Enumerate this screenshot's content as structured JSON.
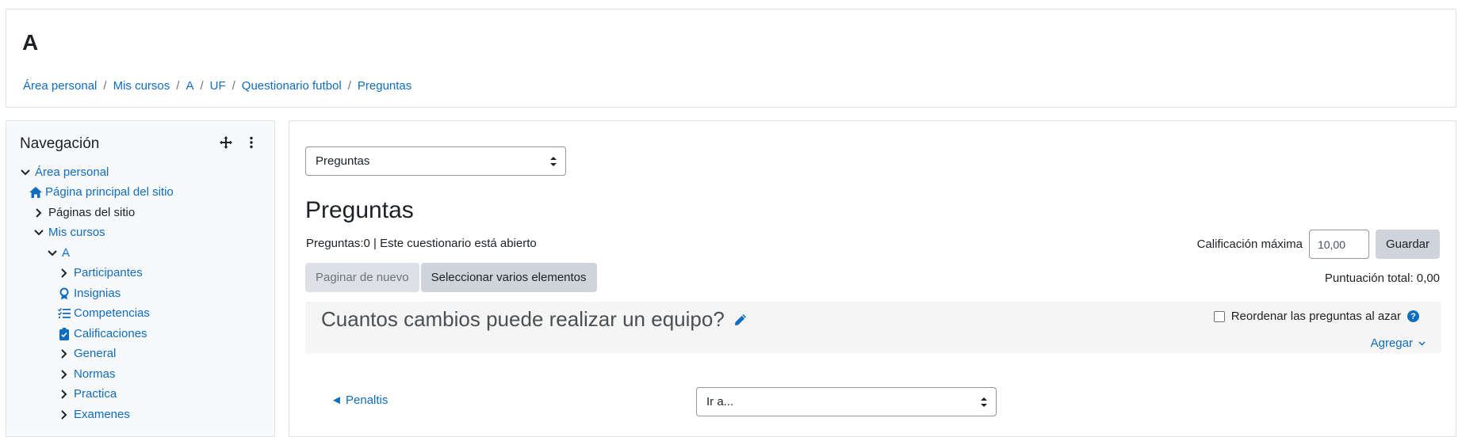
{
  "header": {
    "course_title": "A",
    "breadcrumb": [
      "Área personal",
      "Mis cursos",
      "A",
      "UF",
      "Questionario futbol",
      "Preguntas"
    ],
    "separator": "/"
  },
  "nav": {
    "title": "Navegación",
    "move_icon": "move-icon",
    "menu_icon": "kebab-menu-icon",
    "items": [
      {
        "label": "Área personal",
        "icon": "chevron-down-icon"
      },
      {
        "label": "Página principal del sitio",
        "icon": "home-icon"
      },
      {
        "label": "Páginas del sitio",
        "icon": "chevron-right-icon"
      },
      {
        "label": "Mis cursos",
        "icon": "chevron-down-icon"
      },
      {
        "label": "A",
        "icon": "chevron-down-icon"
      },
      {
        "label": "Participantes",
        "icon": "chevron-right-icon"
      },
      {
        "label": "Insignias",
        "icon": "badge-icon"
      },
      {
        "label": "Competencias",
        "icon": "checklist-icon"
      },
      {
        "label": "Calificaciones",
        "icon": "clipboard-icon"
      },
      {
        "label": "General",
        "icon": "chevron-right-icon"
      },
      {
        "label": "Normas",
        "icon": "chevron-right-icon"
      },
      {
        "label": "Practica",
        "icon": "chevron-right-icon"
      },
      {
        "label": "Examenes",
        "icon": "chevron-right-icon"
      }
    ]
  },
  "main": {
    "page_select": "Preguntas",
    "heading": "Preguntas",
    "info": "Preguntas:0 | Este cuestionario está abierto",
    "max_grade_label": "Calificación máxima",
    "max_grade_value": "10,00",
    "save_label": "Guardar",
    "repaginate_label": "Paginar de nuevo",
    "select_multiple_label": "Seleccionar varios elementos",
    "total_label": "Puntuación total: 0,00",
    "section_title": "Cuantos cambios puede realizar un equipo?",
    "shuffle_label": "Reordenar las preguntas al azar",
    "shuffle_checked": false,
    "add_label": "Agregar",
    "prev_link": "◄ Penaltis",
    "jump_select": "Ir a..."
  },
  "colors": {
    "link": "#0f6cbf",
    "section_bg": "#f5f5f5",
    "button_bg": "#ced4da"
  }
}
